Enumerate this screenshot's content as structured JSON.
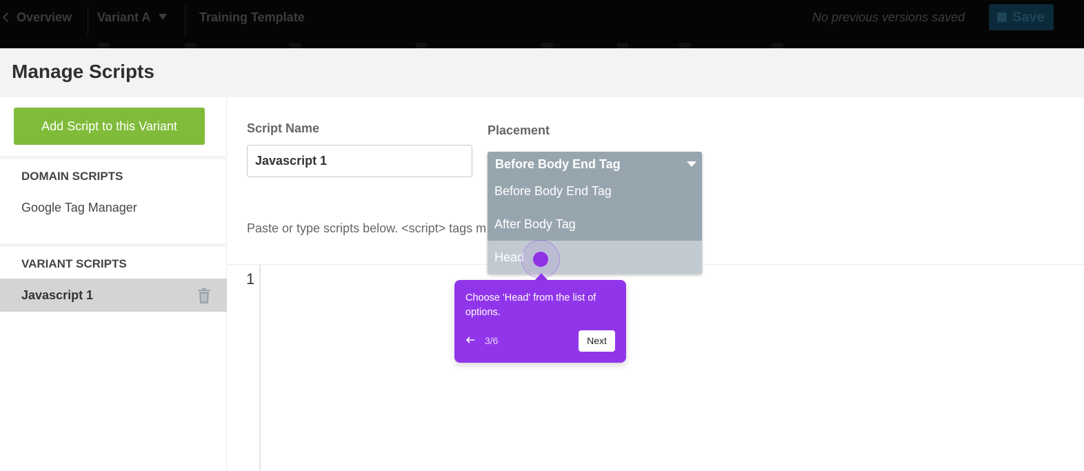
{
  "topbar": {
    "overview_label": "Overview",
    "variant_label": "Variant A",
    "template_label": "Training Template",
    "versions_text": "No previous versions saved",
    "save_label": "Save"
  },
  "header": {
    "title": "Manage Scripts"
  },
  "sidebar": {
    "add_button": "Add Script to this Variant",
    "domain_heading": "DOMAIN SCRIPTS",
    "domain_items": [
      "Google Tag Manager"
    ],
    "variant_heading": "VARIANT SCRIPTS",
    "variant_items": [
      "Javascript 1"
    ]
  },
  "main": {
    "script_name_label": "Script Name",
    "script_name_value": "Javascript 1",
    "placement_label": "Placement",
    "hint": "Paste or type scripts below. <script> tags m",
    "line_number": "1"
  },
  "dropdown": {
    "selected": "Before Body End Tag",
    "options": [
      "Before Body End Tag",
      "After Body Tag",
      "Head"
    ],
    "highlighted": "Head"
  },
  "tooltip": {
    "text": "Choose 'Head' from the list of options.",
    "step": "3/6",
    "next_label": "Next"
  },
  "colors": {
    "accent_green": "#80bc3a",
    "tooltip_purple": "#9135ea",
    "dropdown_bg": "#97a5af"
  }
}
